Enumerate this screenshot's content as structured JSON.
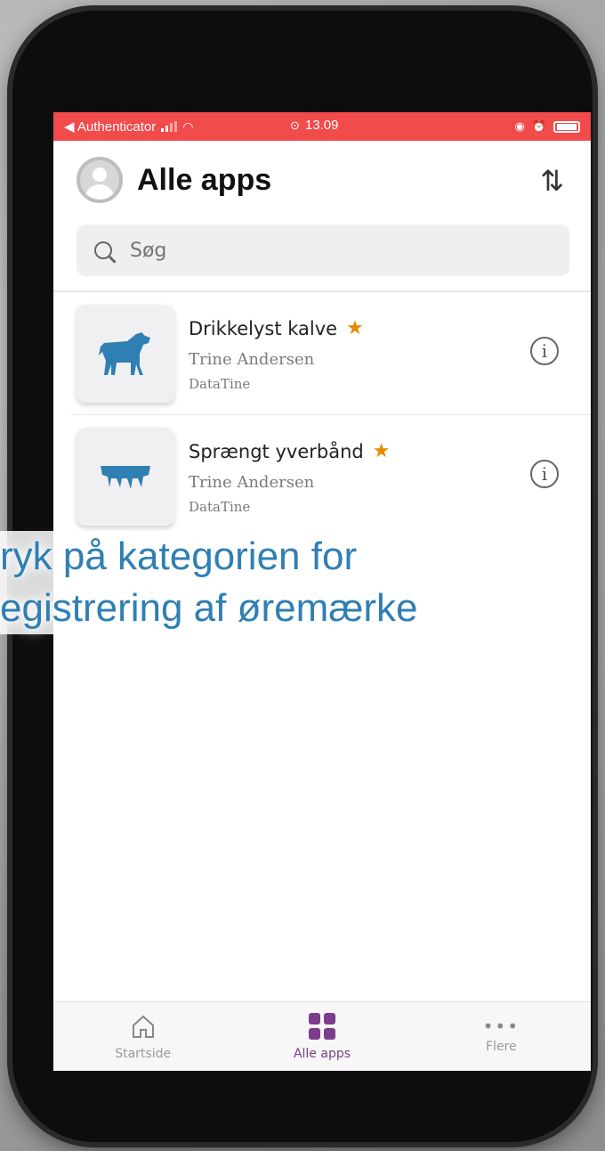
{
  "status_bar": {
    "back_app": "◀ Authenticator",
    "time": "13.09"
  },
  "header": {
    "title": "Alle apps",
    "sort_icon": "sort-arrows-icon"
  },
  "search": {
    "placeholder": "Søg"
  },
  "apps": [
    {
      "name": "Drikkelyst kalve",
      "owner": "Trine Andersen",
      "org": "DataTine",
      "favorite": true,
      "icon": "calf-icon"
    },
    {
      "name": "Sprængt yverbånd",
      "owner": "Trine Andersen",
      "org": "DataTine",
      "favorite": true,
      "icon": "udder-icon"
    }
  ],
  "tabs": [
    {
      "label": "Startside",
      "icon": "home-icon"
    },
    {
      "label": "Alle apps",
      "icon": "grid-icon",
      "active": true
    },
    {
      "label": "Flere",
      "icon": "more-icon"
    }
  ],
  "overlay_caption": {
    "line1": "ryk på kategorien for",
    "line2": "egistrering af øremærke"
  },
  "colors": {
    "status_bar": "#f24b4b",
    "accent": "#7c3d8d",
    "app_icon": "#2f7fb3",
    "star": "#e58a00"
  }
}
